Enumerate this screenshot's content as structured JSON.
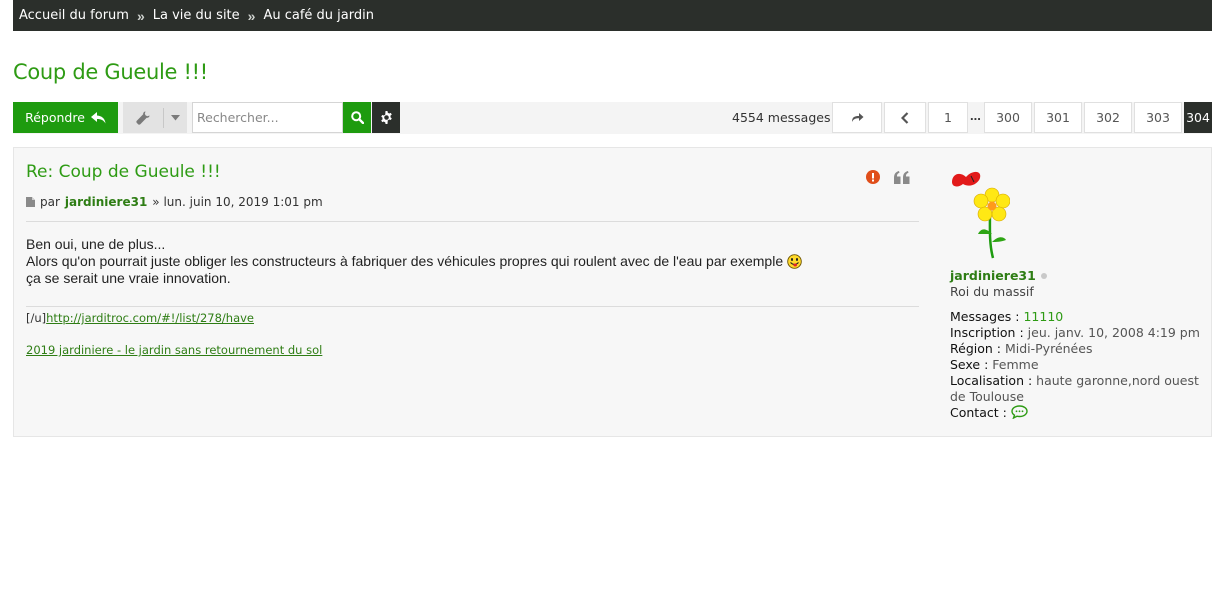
{
  "breadcrumb": [
    {
      "label": "Accueil du forum"
    },
    {
      "label": "La vie du site"
    },
    {
      "label": "Au café du jardin"
    }
  ],
  "topic": {
    "title": "Coup de Gueule !!!"
  },
  "toolbar": {
    "reply_label": "Répondre",
    "search_placeholder": "Rechercher..."
  },
  "pagination": {
    "post_count": "4554 messages",
    "pages": [
      "1",
      "300",
      "301",
      "302",
      "303",
      "304"
    ],
    "ellipsis": "...",
    "current": "304"
  },
  "post": {
    "title": "Re: Coup de Gueule !!!",
    "by": "par",
    "author": "jardiniere31",
    "date": "» lun. juin 10, 2019 1:01 pm",
    "body": [
      "Ben oui, une de plus...",
      "Alors qu'on pourrait juste obliger les constructeurs à fabriquer des véhicules propres qui roulent avec de l'eau par exemple",
      "ça se serait une vraie innovation."
    ],
    "signature": {
      "prefix": "[/u]",
      "link1": "http://jarditroc.com/#!/list/278/have",
      "link2": "2019 jardiniere - le jardin sans retournement du sol"
    }
  },
  "profile": {
    "username": "jardiniere31",
    "rank": "Roi du massif",
    "messages_label": "Messages :",
    "messages_value": "11110",
    "inscription_label": "Inscription :",
    "inscription_value": "jeu. janv. 10, 2008 4:19 pm",
    "region_label": "Région :",
    "region_value": "Midi-Pyrénées",
    "sexe_label": "Sexe :",
    "sexe_value": "Femme",
    "localisation_label": "Localisation :",
    "localisation_value": "haute garonne,nord ouest de Toulouse",
    "contact_label": "Contact :"
  },
  "colors": {
    "brand_green": "#2e9b14",
    "button_green": "#1e9b0f",
    "navbar_dark": "#2b2f2b"
  }
}
